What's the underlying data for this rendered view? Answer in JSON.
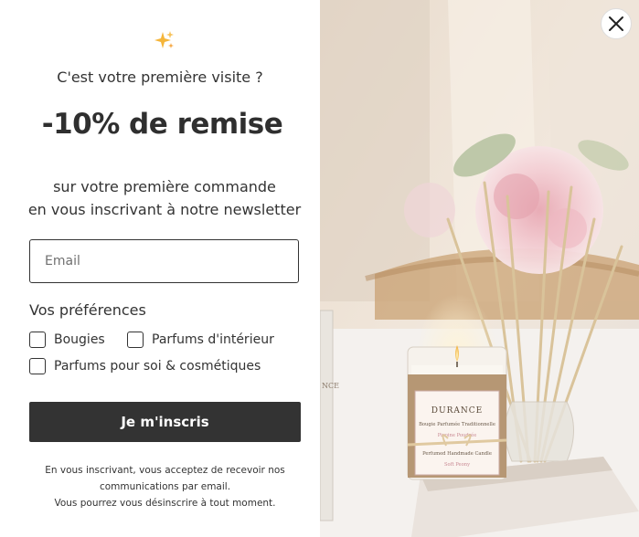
{
  "popup": {
    "icon": "sparkles-icon",
    "visit_question": "C'est votre première visite ?",
    "discount_title": "-10% de remise",
    "subtitle_line1": "sur votre première commande",
    "subtitle_line2": "en vous inscrivant à notre newsletter",
    "email": {
      "placeholder": "Email",
      "value": ""
    },
    "preferences": {
      "title": "Vos préférences",
      "options": [
        {
          "label": "Bougies",
          "checked": false
        },
        {
          "label": "Parfums d'intérieur",
          "checked": false
        },
        {
          "label": "Parfums pour soi & cosmétiques",
          "checked": false
        }
      ]
    },
    "submit_label": "Je m'inscris",
    "legal_line1": "En vous inscrivant, vous acceptez de recevoir nos",
    "legal_line2": "communications par email.",
    "legal_line3": "Vous pourrez vous désinscrire à tout moment.",
    "close_icon": "close-icon",
    "image": {
      "brand": "DURANCE",
      "label_line1": "Bougie Parfumée Traditionnelle",
      "label_line2": "Pivoine Poudrée",
      "label_line3": "Perfumed Handmade Candle",
      "label_line4": "Soft Peony"
    }
  },
  "colors": {
    "accent": "#333333",
    "background": "#ffffff"
  }
}
